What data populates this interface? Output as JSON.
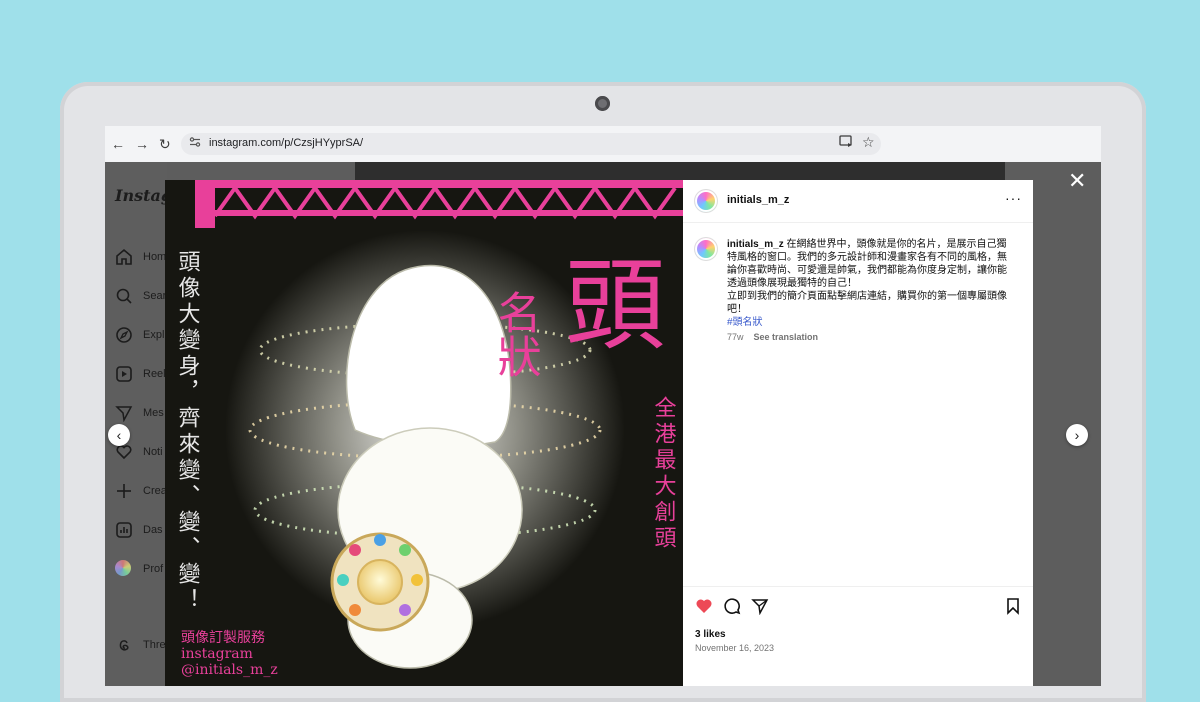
{
  "browser": {
    "back": "←",
    "forward": "→",
    "reload": "↻",
    "url": "instagram.com/p/CzsjHYyprSA/"
  },
  "sidebar": {
    "logo": "Instag",
    "items": [
      {
        "label": "Hom",
        "icon": "home-icon"
      },
      {
        "label": "Sear",
        "icon": "search-icon"
      },
      {
        "label": "Expl",
        "icon": "compass-icon"
      },
      {
        "label": "Reel",
        "icon": "reels-icon"
      },
      {
        "label": "Mes",
        "icon": "send-icon"
      },
      {
        "label": "Noti",
        "icon": "heart-icon"
      },
      {
        "label": "Crea",
        "icon": "plus-icon"
      },
      {
        "label": "Das",
        "icon": "chart-icon"
      },
      {
        "label": "Prof",
        "icon": "avatar-icon"
      },
      {
        "label": "Thre",
        "icon": "threads-icon"
      }
    ]
  },
  "modal": {
    "close": "✕",
    "prev": "‹",
    "next": "›"
  },
  "post_image": {
    "title_top": "頭",
    "title_side": "名狀",
    "slogan_vertical": "頭像大變身，齊來變、變、變！",
    "tagline_vertical": "全港最大創頭",
    "service": "頭像訂製服務",
    "platform": "instagram",
    "handle": "@initials_m_z",
    "colors": {
      "pink": "#e8409a",
      "bg": "#161611"
    }
  },
  "post": {
    "username": "initials_m_z",
    "more": "···",
    "caption_user": "initials_m_z",
    "caption_text": "在網絡世界中，頭像就是你的名片，是展示自己獨特風格的窗口。我們的多元設計師和漫畫家各有不同的風格，無論你喜歡時尚、可愛還是帥氣，我們都能為你度身定制，讓你能透過頭像展現最獨特的自己！",
    "caption_text2": "立即到我們的簡介頁面點擊網店連結，購買你的第一個專屬頭像吧！",
    "hashtag": "#頭名狀",
    "age": "77w",
    "see_translation": "See translation",
    "likes": "3 likes",
    "date": "November 16, 2023"
  }
}
